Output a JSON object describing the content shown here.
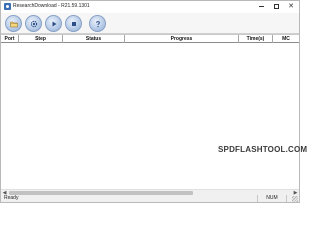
{
  "window": {
    "title": "ResearchDownload - R21.59.1301",
    "minimize_glyph": "",
    "maximize_glyph": "",
    "close_glyph": "✕"
  },
  "toolbar": {
    "buttons": [
      {
        "icon": "load-packet-icon"
      },
      {
        "icon": "settings-icon"
      },
      {
        "icon": "start-icon"
      },
      {
        "icon": "stop-icon"
      },
      {
        "icon": "help-icon"
      }
    ]
  },
  "list": {
    "columns": [
      "Port",
      "Step",
      "Status",
      "Progress",
      "Time(s)",
      "MC"
    ]
  },
  "watermark": "SPDFLASHTOOL.COM",
  "scrollbar": {
    "left_arrow": "◀",
    "right_arrow": "▶"
  },
  "statusbar": {
    "status": "Ready",
    "indicator": "NUM"
  }
}
